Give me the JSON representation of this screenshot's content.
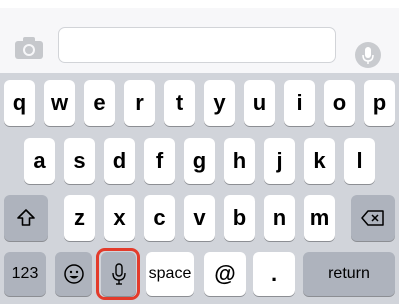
{
  "row1": [
    "q",
    "w",
    "e",
    "r",
    "t",
    "y",
    "u",
    "i",
    "o",
    "p"
  ],
  "row2": [
    "a",
    "s",
    "d",
    "f",
    "g",
    "h",
    "j",
    "k",
    "l"
  ],
  "row3": [
    "z",
    "x",
    "c",
    "v",
    "b",
    "n",
    "m"
  ],
  "bottom": {
    "numbers_label": "123",
    "space_label": "space",
    "at_label": "@",
    "dot_label": ".",
    "return_label": "return"
  },
  "icons": {
    "camera": "camera-icon",
    "mic_circle": "microphone-circle-icon",
    "shift": "shift-icon",
    "delete": "backspace-icon",
    "emoji": "emoji-icon",
    "dictation": "microphone-icon"
  },
  "colors": {
    "keyboard_bg": "#d1d4da",
    "letter_key": "#ffffff",
    "function_key": "#aeb3bd",
    "highlight": "#e33b2b"
  }
}
